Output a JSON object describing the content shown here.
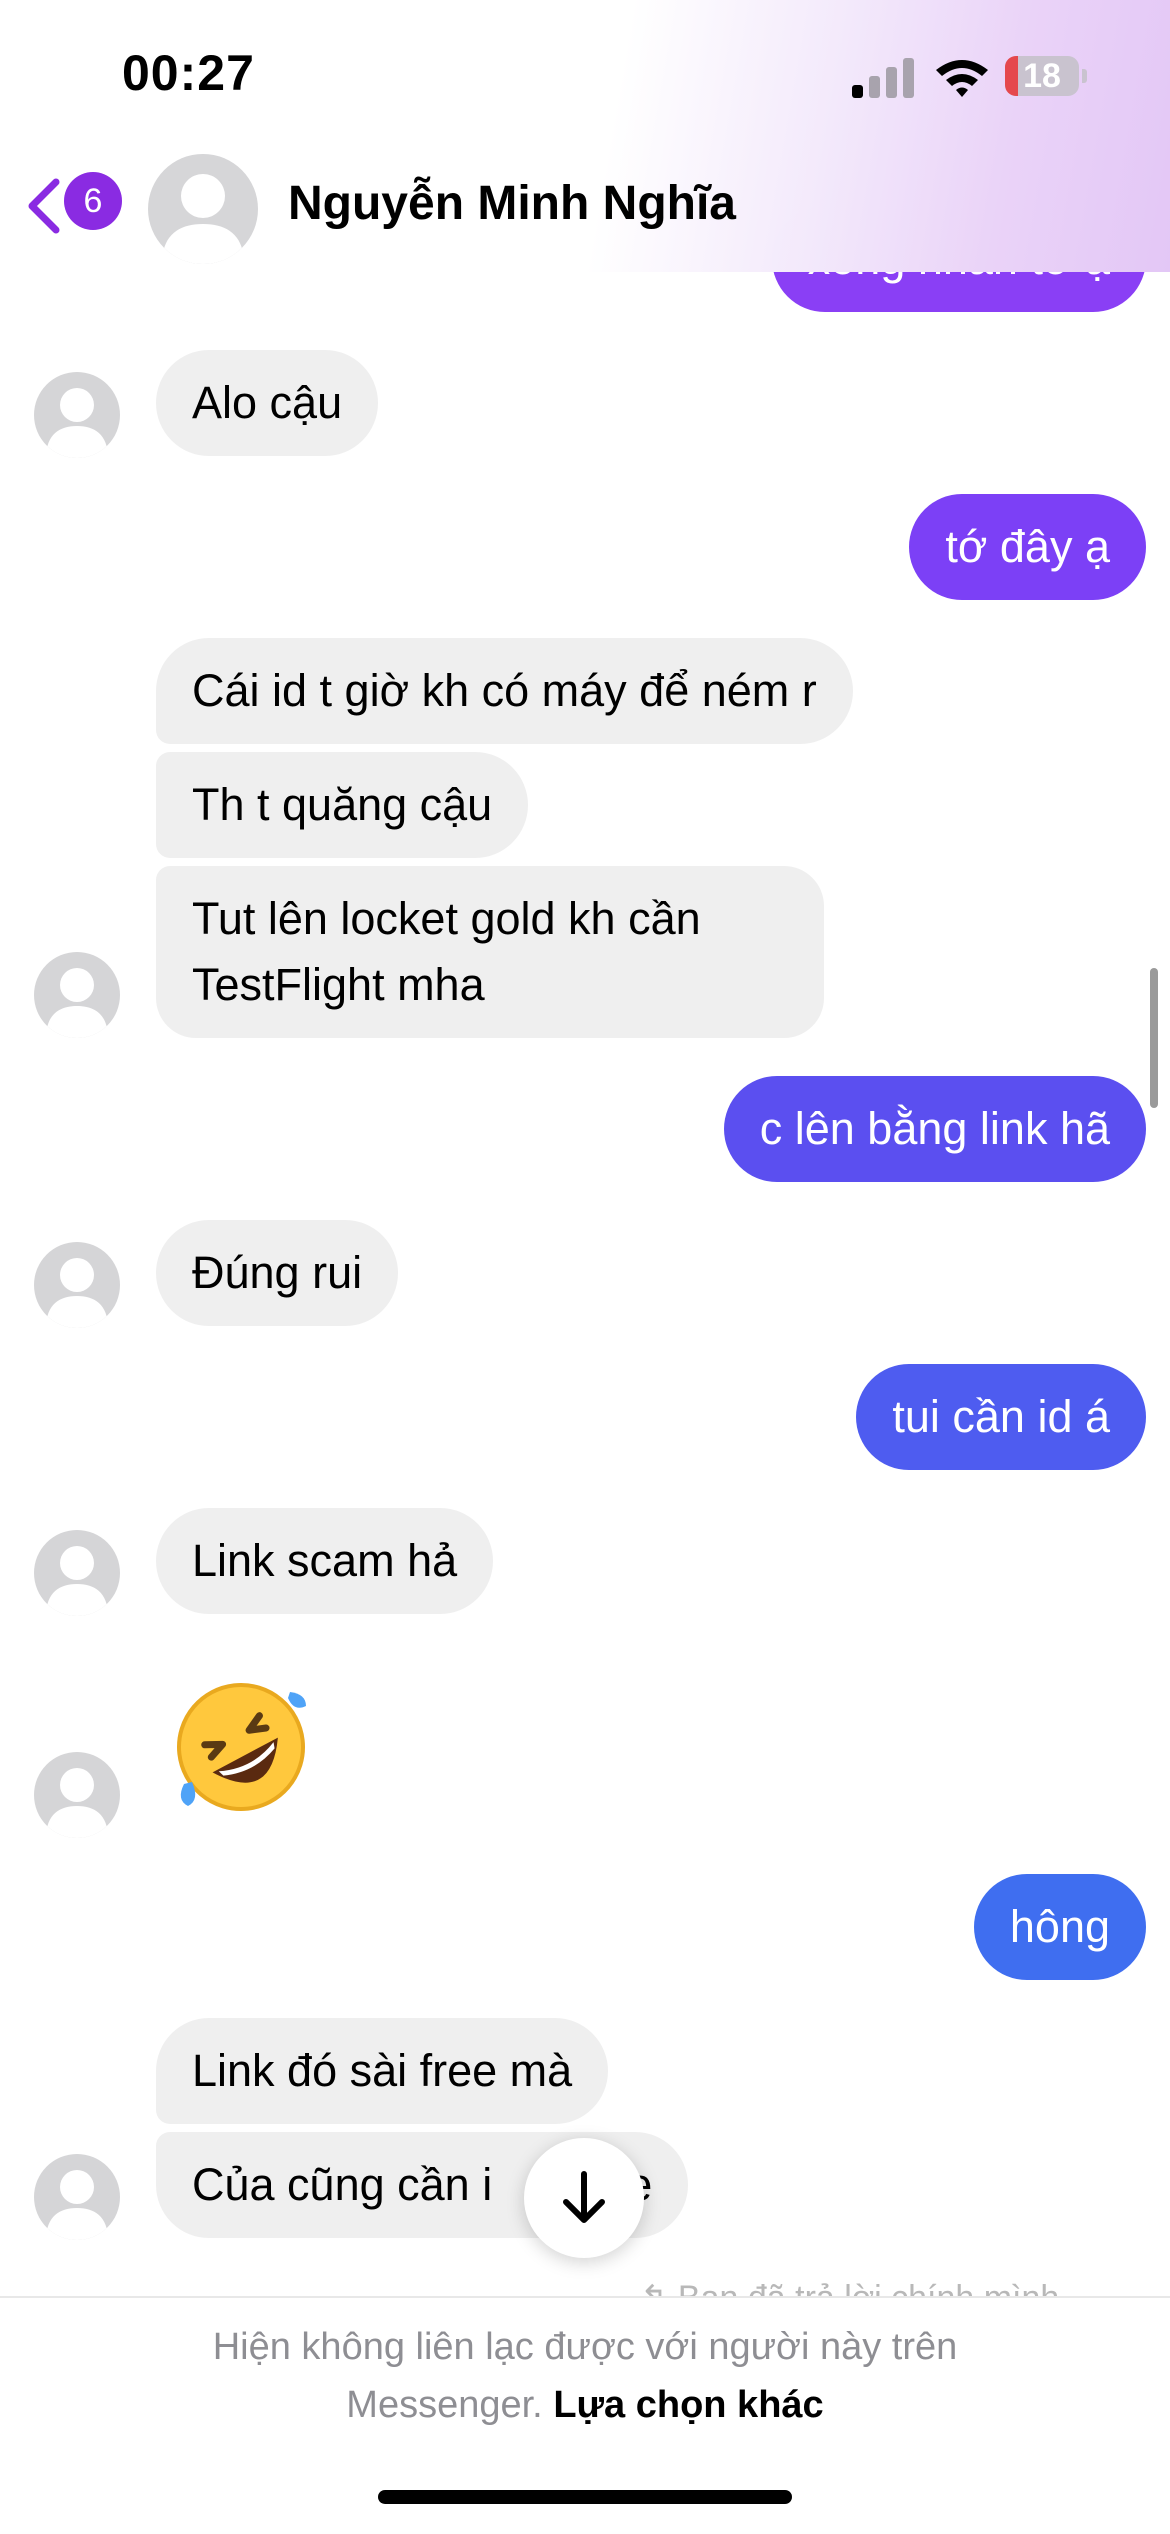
{
  "status_bar": {
    "time": "00:27",
    "battery": "18",
    "battery_level": 0.18,
    "signal_bars_active": 1
  },
  "header": {
    "back_badge": "6",
    "contact_name": "Nguyễn Minh Nghĩa"
  },
  "messages": [
    {
      "side": "out",
      "text": "xong nhắn tớ ạ",
      "color": "#8a3ff5"
    },
    {
      "side": "in",
      "text": "Alo cậu"
    },
    {
      "side": "out",
      "text": "tớ đây ạ",
      "color": "#7c40f6"
    },
    {
      "side": "in",
      "text": "Cái id t giờ kh có máy để ném r"
    },
    {
      "side": "in",
      "text": "Th t quăng cậu"
    },
    {
      "side": "in",
      "text": "Tut lên locket gold kh cần TestFlight mha"
    },
    {
      "side": "out",
      "text": "c lên bằng link hã",
      "color": "#5b4ff0"
    },
    {
      "side": "in",
      "text": "Đúng rui"
    },
    {
      "side": "out",
      "text": "tui cần id á",
      "color": "#4e5cf0"
    },
    {
      "side": "in",
      "text": "Link scam hả"
    },
    {
      "side": "in",
      "text": "🤣",
      "kind": "emoji"
    },
    {
      "side": "out",
      "text": "hông",
      "color": "#3f6ef0"
    },
    {
      "side": "in",
      "text": "Link đó sài free mà"
    },
    {
      "side": "in",
      "text": "Của cũng cần i          le"
    }
  ],
  "replied_hint": "↰ Bạn đã trả lời chính mình",
  "footer": {
    "line1": "Hiện không liên lạc được với người này trên",
    "line2_gray": "Messenger.",
    "line2_link": "Lựa chọn khác"
  },
  "icons": {
    "back": "chevron-left-icon",
    "scroll_down": "arrow-down-icon",
    "emoji": "rolling-on-floor-laughing-emoji"
  }
}
